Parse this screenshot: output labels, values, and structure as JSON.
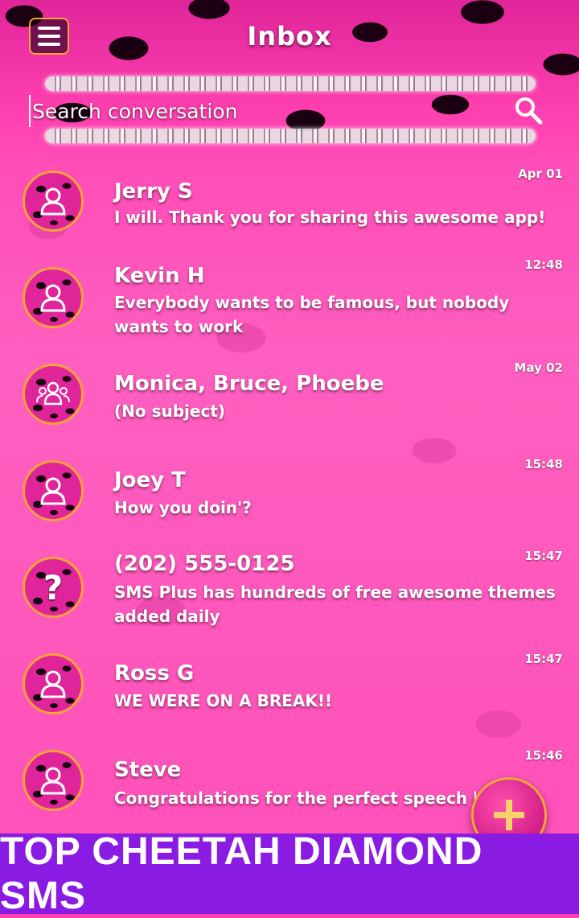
{
  "header": {
    "title": "Inbox",
    "search_placeholder": "Search conversation"
  },
  "icons": {
    "menu": "hamburger-menu-icon",
    "search": "search-icon",
    "contact": "person-icon",
    "group": "group-icon",
    "unknown": "question-mark-icon",
    "compose": "plus-icon"
  },
  "colors": {
    "accent_ring": "#f4a23a",
    "banner": "#8a1be2",
    "background": "#ff4fb8"
  },
  "conversations": [
    {
      "name": "Jerry S",
      "snippet": " I will. Thank you for sharing this awesome app!",
      "time": "Apr 01",
      "avatar": "contact"
    },
    {
      "name": "Kevin H",
      "snippet": " Everybody wants to be famous, but nobody wants to work",
      "time": "12:48",
      "avatar": "contact"
    },
    {
      "name": "Monica, Bruce, Phoebe",
      "snippet": "(No subject)",
      "time": "May 02",
      "avatar": "group"
    },
    {
      "name": "Joey T",
      "snippet": " How you doin'?",
      "time": "15:48",
      "avatar": "contact"
    },
    {
      "name": "(202) 555-0125",
      "snippet": " SMS Plus has hundreds of free awesome themes added daily",
      "time": "15:47",
      "avatar": "unknown",
      "avatar_text": "?"
    },
    {
      "name": "Ross G",
      "snippet": " WE WERE ON A BREAK!!",
      "time": "15:47",
      "avatar": "contact"
    },
    {
      "name": "Steve",
      "snippet": " Congratulations for the perfect speech held t",
      "time": "15:46",
      "avatar": "contact"
    }
  ],
  "banner": {
    "text": "TOP CHEETAH DIAMOND SMS"
  }
}
